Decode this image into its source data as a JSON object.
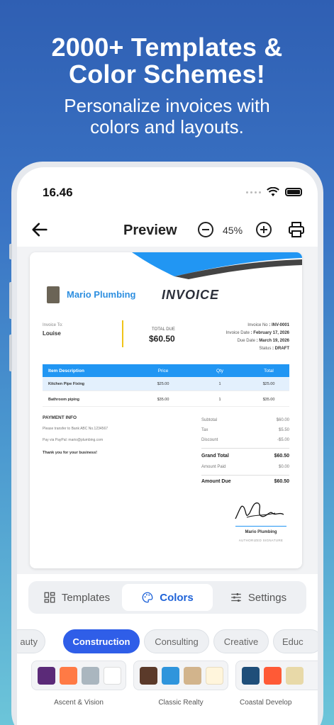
{
  "promo": {
    "headline_line1": "2000+ Templates &",
    "headline_line2": "Color Schemes!",
    "sub_line1": "Personalize invoices with",
    "sub_line2": "colors and layouts."
  },
  "status_bar": {
    "time": "16.46"
  },
  "app_bar": {
    "title": "Preview",
    "zoom": "45%"
  },
  "invoice": {
    "company": "Mario Plumbing",
    "title": "INVOICE",
    "invoice_to_label": "Invoice To:",
    "invoice_to": "Louise",
    "total_due_label": "TOTAL DUE",
    "total_due": "$60.50",
    "meta": [
      {
        "label": "Invoice No",
        "value": ": INV-0001"
      },
      {
        "label": "Invoice Date",
        "value": ": February 17, 2026"
      },
      {
        "label": "Due Date",
        "value": ": March 19, 2026"
      },
      {
        "label": "Status",
        "value": ": DRAFT"
      }
    ],
    "columns": [
      "Item Description",
      "Price",
      "Qty",
      "Total"
    ],
    "rows": [
      {
        "desc": "Kitchen Pipe Fixing",
        "price": "$25.00",
        "qty": "1",
        "total": "$25.00"
      },
      {
        "desc": "Bathroom piping",
        "price": "$35.00",
        "qty": "1",
        "total": "$35.00"
      }
    ],
    "payment_title": "PAYMENT INFO",
    "payment_bank": "Please transfer to Bank ABC No.1234567",
    "payment_paypal": "Pay via PayPal: mario@plumbing.com",
    "thanks": "Thank you for your business!",
    "summary": [
      {
        "label": "Subtotal",
        "value": "$60.00"
      },
      {
        "label": "Tax",
        "value": "$5.50"
      },
      {
        "label": "Discount",
        "value": "-$5.00"
      },
      {
        "label": "Grand Total",
        "value": "$60.50"
      },
      {
        "label": "Amount Paid",
        "value": "$0.00"
      },
      {
        "label": "Amount Due",
        "value": "$60.50"
      }
    ],
    "signer": "Mario Plumbing",
    "signature_label": "AUTHORIZED SIGNATURE"
  },
  "tabs": [
    {
      "label": "Templates",
      "icon": "grid-icon"
    },
    {
      "label": "Colors",
      "icon": "palette-icon"
    },
    {
      "label": "Settings",
      "icon": "sliders-icon"
    }
  ],
  "categories": [
    "auty",
    "Construction",
    "Consulting",
    "Creative",
    "Educ"
  ],
  "palettes": [
    {
      "name": "Ascent & Vision",
      "colors": [
        "#5b2a78",
        "#ff7a45",
        "#aab6bf",
        "#ffffff"
      ]
    },
    {
      "name": "Classic Realty",
      "colors": [
        "#5b3a2a",
        "#2f95dc",
        "#d2b48c",
        "#fff5dc"
      ]
    },
    {
      "name": "Coastal Develop",
      "colors": [
        "#1f4e79",
        "#ff5a36",
        "#e8d9a8"
      ]
    }
  ],
  "colors": {
    "accent": "#2f5ee8",
    "invoice_blue": "#2196f3",
    "highlight_row": "#e3f0fd"
  }
}
